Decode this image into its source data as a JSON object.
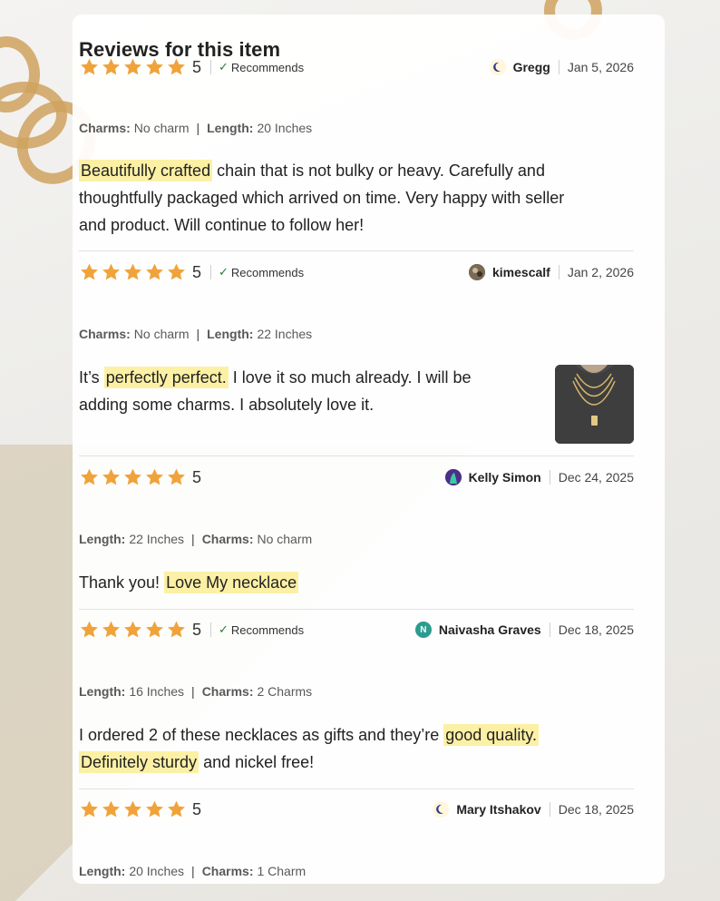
{
  "title": "Reviews for this item",
  "colors": {
    "star": "#f0a33a",
    "highlight": "#fcf0a5",
    "recommends_check": "#2b7d3a"
  },
  "reviews": [
    {
      "rating": "5",
      "recommends": "Recommends",
      "author": "Gregg",
      "avatar_icon": "etsy-moon-avatar-icon",
      "date": "Jan 5, 2026",
      "attrs": [
        {
          "label": "Charms:",
          "value": "No charm"
        },
        {
          "label": "Length:",
          "value": "20 Inches"
        }
      ],
      "text": {
        "highlight": "Beautifully crafted",
        "line1": "chain that is not bulky or heavy. Carefully and",
        "line2": "thoughtfully packaged which arrived on time. Very happy with seller",
        "line3": "and product. Will continue to follow her!"
      }
    },
    {
      "rating": "5",
      "recommends": "Recommends",
      "author": "kimescalf",
      "avatar_icon": "photo-avatar-icon",
      "date": "Jan 2, 2026",
      "attrs": [
        {
          "label": "Charms:",
          "value": "No charm"
        },
        {
          "label": "Length:",
          "value": "22 Inches"
        }
      ],
      "text": {
        "before": "It’s",
        "highlight": "perfectly perfect.",
        "line1": "I love it so much already. I will be",
        "line2": "adding some charms. I absolutely love it."
      },
      "photo_icon": "review-photo-necklace"
    },
    {
      "rating": "5",
      "author": "Kelly Simon",
      "avatar_icon": "photo-avatar-icon",
      "date": "Dec 24, 2025",
      "attrs": [
        {
          "label": "Length:",
          "value": "22 Inches"
        },
        {
          "label": "Charms:",
          "value": "No charm"
        }
      ],
      "text": {
        "before": "Thank you!",
        "highlight": "Love My necklace"
      }
    },
    {
      "rating": "5",
      "recommends": "Recommends",
      "author": "Naivasha Graves",
      "avatar_letter": "N",
      "avatar_color": "#2a9d8f",
      "date": "Dec 18, 2025",
      "attrs": [
        {
          "label": "Length:",
          "value": "16 Inches"
        },
        {
          "label": "Charms:",
          "value": "2 Charms"
        }
      ],
      "text": {
        "line1": "I ordered 2 of these necklaces as gifts and they’re",
        "highlight1": "good quality.",
        "highlight2": "Definitely sturdy",
        "line2": "and nickel free!"
      }
    },
    {
      "rating": "5",
      "author": "Mary Itshakov",
      "avatar_icon": "etsy-moon-avatar-icon",
      "date": "Dec 18, 2025",
      "attrs": [
        {
          "label": "Length:",
          "value": "20 Inches"
        },
        {
          "label": "Charms:",
          "value": "1 Charm"
        }
      ]
    }
  ]
}
